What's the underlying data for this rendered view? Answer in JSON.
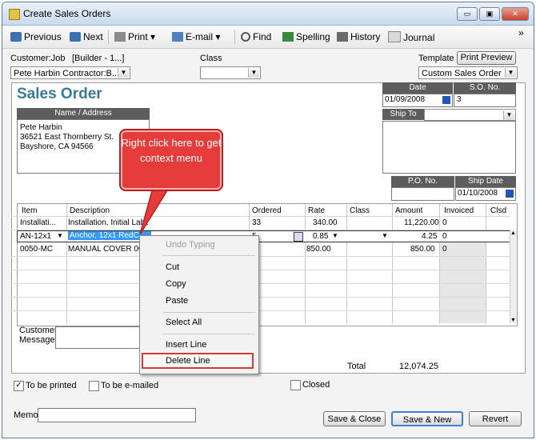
{
  "window": {
    "title": "Create Sales Orders",
    "minimize": "▭",
    "restore": "▣",
    "close": "✕"
  },
  "toolbar": {
    "previous": "Previous",
    "next": "Next",
    "print": "Print",
    "email": "E-mail",
    "find": "Find",
    "spelling": "Spelling",
    "history": "History",
    "journal": "Journal",
    "more": "»"
  },
  "header": {
    "customer_label": "Customer:Job",
    "customer_hint": "[Builder - 1...]",
    "customer_value": "Pete Harbin Contractor:B...",
    "class_label": "Class",
    "class_value": "",
    "template_label": "Template",
    "print_preview": "Print Preview",
    "template_value": "Custom Sales Order"
  },
  "form": {
    "title": "Sales Order",
    "date_label": "Date",
    "date_value": "01/09/2008",
    "so_label": "S.O. No.",
    "so_value": "3",
    "name_address_label": "Name / Address",
    "address_lines": [
      "Pete Harbin",
      "36521 East Thornberry St.",
      "Bayshore, CA 94566"
    ],
    "ship_to_label": "Ship To",
    "po_label": "P.O. No.",
    "po_value": "",
    "ship_date_label": "Ship Date",
    "ship_date_value": "01/10/2008"
  },
  "grid": {
    "columns": [
      "Item",
      "Description",
      "Ordered",
      "Rate",
      "Class",
      "Amount",
      "Invoiced",
      "Clsd"
    ],
    "rows": [
      {
        "item": "Installati...",
        "description": "Installation, Initial Labor",
        "ordered": "33",
        "rate": "340.00",
        "class": "",
        "amount": "11,220.00",
        "invoiced": "0"
      },
      {
        "item": "AN-12x1",
        "description": "Anchor, 12x1 RedC",
        "ordered": "5",
        "rate": "0.85",
        "class": "",
        "amount": "4.25",
        "invoiced": "0"
      },
      {
        "item": "0050-MC",
        "description": "MANUAL COVER 00",
        "ordered": "",
        "rate": "850.00",
        "class": "",
        "amount": "850.00",
        "invoiced": "0"
      }
    ]
  },
  "context_menu": {
    "undo": "Undo Typing",
    "cut": "Cut",
    "copy": "Copy",
    "paste": "Paste",
    "select_all": "Select All",
    "insert_line": "Insert Line",
    "delete_line": "Delete Line"
  },
  "callout": {
    "text": "Right click here to get context menu"
  },
  "footer": {
    "customer_message_label": "Customer Message",
    "total_label": "Total",
    "total_value": "12,074.25",
    "to_be_printed": "To be printed",
    "to_be_emailed": "To be e-mailed",
    "closed": "Closed",
    "memo_label": "Memo",
    "save_close": "Save & Close",
    "save_new": "Save & New",
    "revert": "Revert"
  },
  "colors": {
    "accent": "#3a7a99",
    "callout": "#e53b3b",
    "highlight": "#3399ff"
  }
}
